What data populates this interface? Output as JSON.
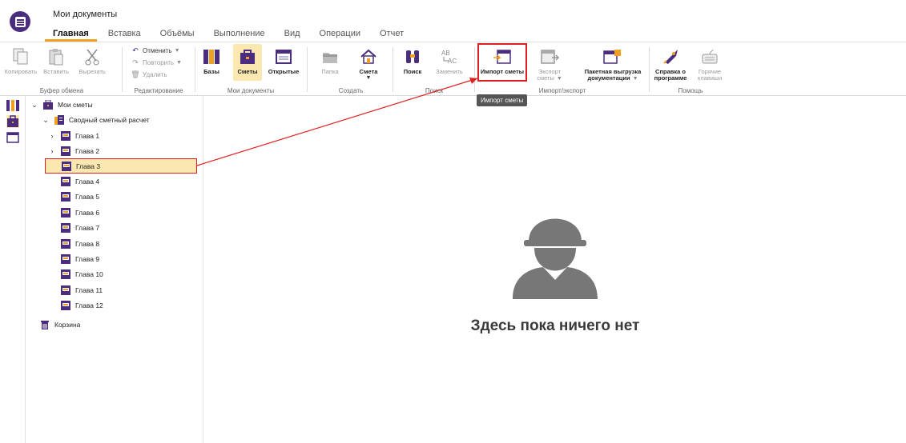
{
  "app": {
    "title": "Мои документы"
  },
  "tabs": [
    {
      "label": "Главная",
      "active": true
    },
    {
      "label": "Вставка"
    },
    {
      "label": "Объёмы"
    },
    {
      "label": "Выполнение"
    },
    {
      "label": "Вид"
    },
    {
      "label": "Операции"
    },
    {
      "label": "Отчет"
    }
  ],
  "ribbon": {
    "clipboard": {
      "label": "Буфер обмена",
      "copy": "Копировать",
      "paste": "Вставить",
      "cut": "Вырезать"
    },
    "editing": {
      "label": "Редактирование",
      "undo": "Отменить",
      "redo": "Повторить",
      "delete": "Удалить"
    },
    "my_docs": {
      "label": "Мои документы",
      "bases": "Базы",
      "estimates": "Сметы",
      "open": "Открытые"
    },
    "create": {
      "label": "Создать",
      "folder": "Папка",
      "estimate": "Смета"
    },
    "search": {
      "label": "Поиск",
      "find": "Поиск",
      "replace": "Заменить"
    },
    "import_export": {
      "label": "Импорт/экспорт",
      "import": "Импорт сметы",
      "export": "Экспорт сметы",
      "batch": "Пакетная выгрузка документации"
    },
    "help": {
      "label": "Помощь",
      "about": "Справка о программе",
      "hotkeys": "Горячие клавиши"
    }
  },
  "tooltip": "Импорт сметы",
  "tree": {
    "root": "Мои сметы",
    "summary": "Сводный сметный расчет",
    "chapters": [
      "Глава 1",
      "Глава 2",
      "Глава 3",
      "Глава 4",
      "Глава 5",
      "Глава 6",
      "Глава 7",
      "Глава 8",
      "Глава 9",
      "Глава 10",
      "Глава 11",
      "Глава 12"
    ],
    "trash": "Корзина"
  },
  "empty_state": {
    "text": "Здесь пока ничего нет"
  },
  "colors": {
    "accent": "#4a2d7f",
    "highlight": "#fbe8b0",
    "annotation": "#e02020",
    "tab_underline": "#f0a020"
  }
}
